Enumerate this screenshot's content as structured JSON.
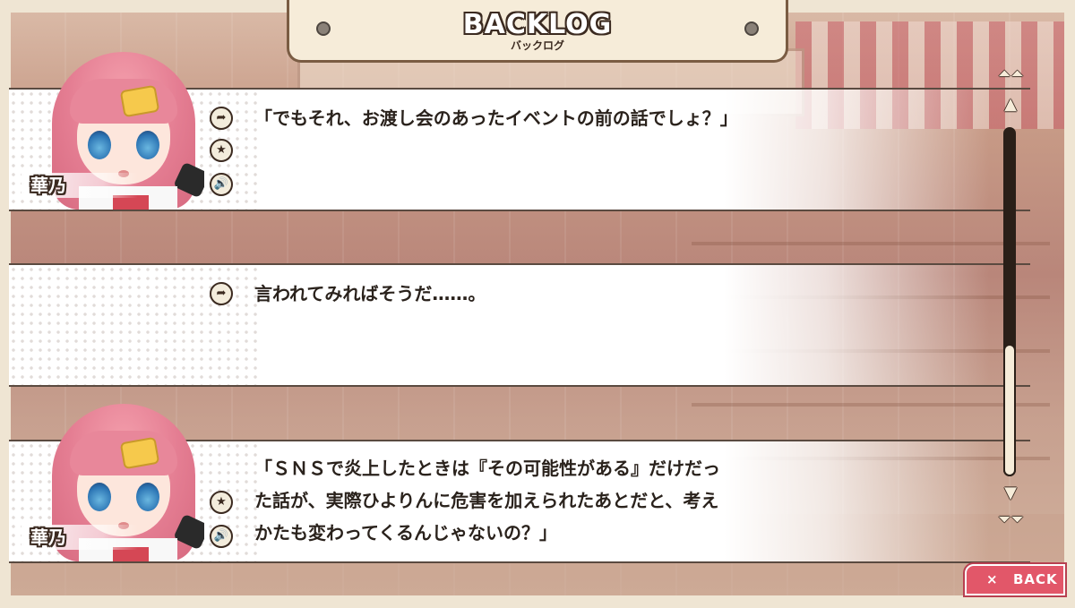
{
  "header": {
    "title": "BACKLOG",
    "subtitle": "バックログ"
  },
  "entries": [
    {
      "speaker": "華乃",
      "lines": [
        "「でもそれ、お渡し会のあったイベントの前の話でしょ？」"
      ],
      "icons": [
        "jump-icon",
        "favorite-icon",
        "voice-icon"
      ]
    },
    {
      "speaker": "",
      "lines": [
        "言われてみればそうだ……。"
      ],
      "icons": [
        "jump-icon"
      ]
    },
    {
      "speaker": "華乃",
      "lines": [
        "「ＳＮＳで炎上したときは『その可能性がある』だけだっ",
        "た話が、実際ひよりんに危害を加えられたあとだと、考え",
        "かたも変わってくるんじゃないの？」"
      ],
      "icons": [
        "favorite-icon",
        "voice-icon"
      ]
    }
  ],
  "glyphs": {
    "jump": "➦",
    "favorite": "★",
    "voice": "🔊",
    "scroll_top": "⏶⏶",
    "scroll_up": "▲",
    "scroll_down": "▼",
    "scroll_bottom": "⏷⏷",
    "close": "×"
  },
  "scrollbar": {
    "position": 1.0
  },
  "back_button": {
    "label": "BACK"
  },
  "colors": {
    "frame": "#efe5d3",
    "outline": "#3b2a20",
    "back_button": "#e25769"
  }
}
